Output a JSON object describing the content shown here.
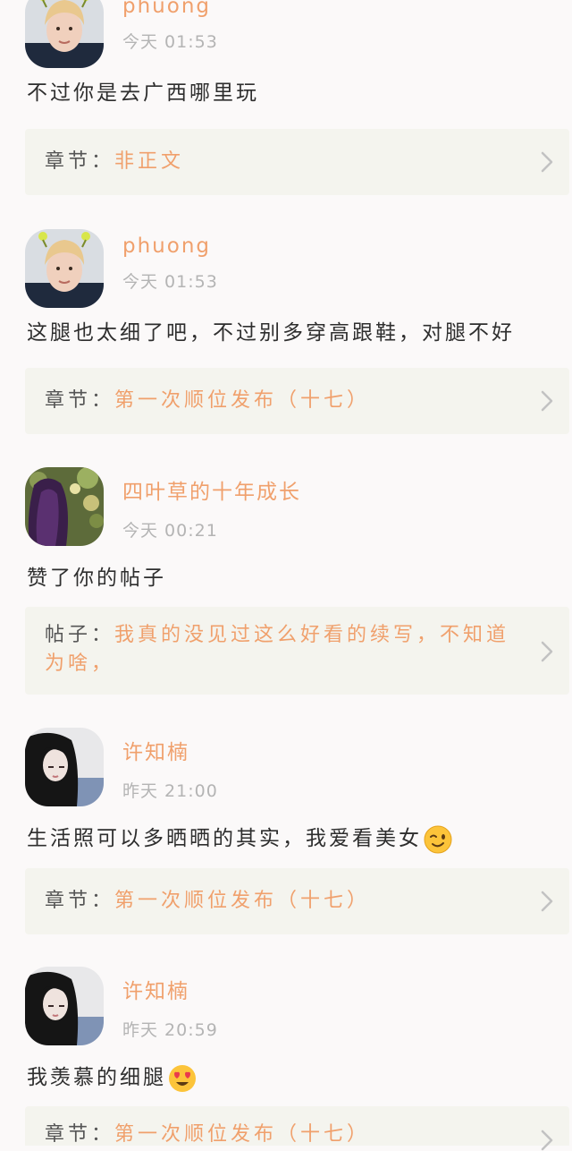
{
  "comments": [
    {
      "username": "phuong",
      "time": "今天 01:53",
      "content": "不过你是去广西哪里玩",
      "emoji": "",
      "ref_label": "章节",
      "ref_colon": "：",
      "ref_title": "非正文",
      "avatar_icon": "blonde-boy-avatar"
    },
    {
      "username": "phuong",
      "time": "今天 01:53",
      "content": "这腿也太细了吧，不过别多穿高跟鞋，对腿不好",
      "emoji": "",
      "ref_label": "章节",
      "ref_colon": "：",
      "ref_title": "第一次顺位发布（十七）",
      "avatar_icon": "blonde-boy-avatar"
    },
    {
      "username": "四叶草的十年成长",
      "time": "今天 00:21",
      "content": "赞了你的帖子",
      "emoji": "",
      "ref_label": "帖子",
      "ref_colon": "：",
      "ref_title": "我真的没见过这么好看的续写，不知道为啥，",
      "avatar_icon": "purple-hair-girl-avatar"
    },
    {
      "username": "许知楠",
      "time": "昨天 21:00",
      "content": "生活照可以多晒晒的其实，我爱看美女",
      "emoji": "wink-emoji",
      "ref_label": "章节",
      "ref_colon": "：",
      "ref_title": "第一次顺位发布（十七）",
      "avatar_icon": "dark-hair-girl-avatar"
    },
    {
      "username": "许知楠",
      "time": "昨天 20:59",
      "content": "我羡慕的细腿",
      "emoji": "heart-eyes-emoji",
      "ref_label": "章节",
      "ref_colon": "：",
      "ref_title": "第一次顺位发布（十七）",
      "avatar_icon": "dark-hair-girl-avatar"
    }
  ],
  "colors": {
    "accent": "#f0a06c",
    "background": "#fbf9f9",
    "card": "#f4f4ee",
    "muted": "#b4b4b4",
    "text": "#2e2e2e"
  }
}
